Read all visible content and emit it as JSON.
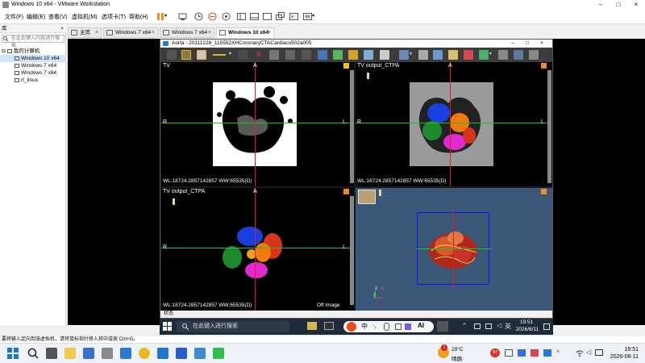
{
  "vmware": {
    "title": "Windows 10 x64 - VMware Workstation",
    "menu": [
      "文件(F)",
      "编辑(E)",
      "查看(V)",
      "虚拟机(M)",
      "选项卡(T)",
      "帮助(H)"
    ]
  },
  "library": {
    "header": "库",
    "close": "×",
    "search_placeholder": "在此处键入内容进行搜索",
    "root": "我的计算机",
    "items": [
      "Windows 10 x64",
      "Windows 7 x64",
      "Windows 7 x64",
      "rt_linux"
    ]
  },
  "tabs": [
    {
      "label": "主页",
      "active": false
    },
    {
      "label": "Windows 7 x64",
      "active": false
    },
    {
      "label": "Windows 7 x64",
      "active": false
    },
    {
      "label": "Windows 10 x64",
      "active": true
    }
  ],
  "app": {
    "title": "Aorta - 20111228_115552XHCoronaryCTACardiacs502a005",
    "status": "状态"
  },
  "panes": {
    "tl": {
      "label": "TV",
      "top_marker": "A",
      "left_marker": "R",
      "right_marker": "L",
      "wlww": "WL:18724.2857142857 WW:65535(D)"
    },
    "tr": {
      "label": "TV output_CTPA",
      "top_marker": "A",
      "left_marker": "R",
      "right_marker": "L",
      "wlww": "WL:18724.2857142857 WW:65535(D)"
    },
    "bl": {
      "label": "TV output_CTPA",
      "top_marker": "A",
      "left_marker": "R",
      "right_marker": "L",
      "wlww": "WL:18724.2857142857 WW:65535(D)",
      "corner_text": "Off Image"
    },
    "br": {
      "axis_z": "z",
      "axis_x": "x",
      "axis_y": "y"
    }
  },
  "guest_taskbar": {
    "search_placeholder": "在此键入进行搜索",
    "ime_lang": "英",
    "time": "19:51",
    "date": "2026/6/11",
    "ime_items": [
      "中",
      "·,",
      "AI"
    ]
  },
  "vm_hint": "要将输入定向到该虚拟机，请将鼠标指针移入其中或按 Ctrl+G。",
  "host_taskbar": {
    "weather_temp": "29°C",
    "weather_desc": "晴朗",
    "weather_badge": "1",
    "badge_count": "97",
    "time": "19:51",
    "date": "2026-06-11"
  },
  "colors": {
    "accent_orange": "#f28c1c",
    "crosshair_red": "#e02020",
    "crosshair_green": "#20c020",
    "heart_blue": "#1a3fe0",
    "heart_orange": "#f07a10",
    "heart_green": "#1e8a2e",
    "heart_magenta": "#e02ad0",
    "heart_red": "#d8341a",
    "volume_bg": "#3b5878"
  }
}
